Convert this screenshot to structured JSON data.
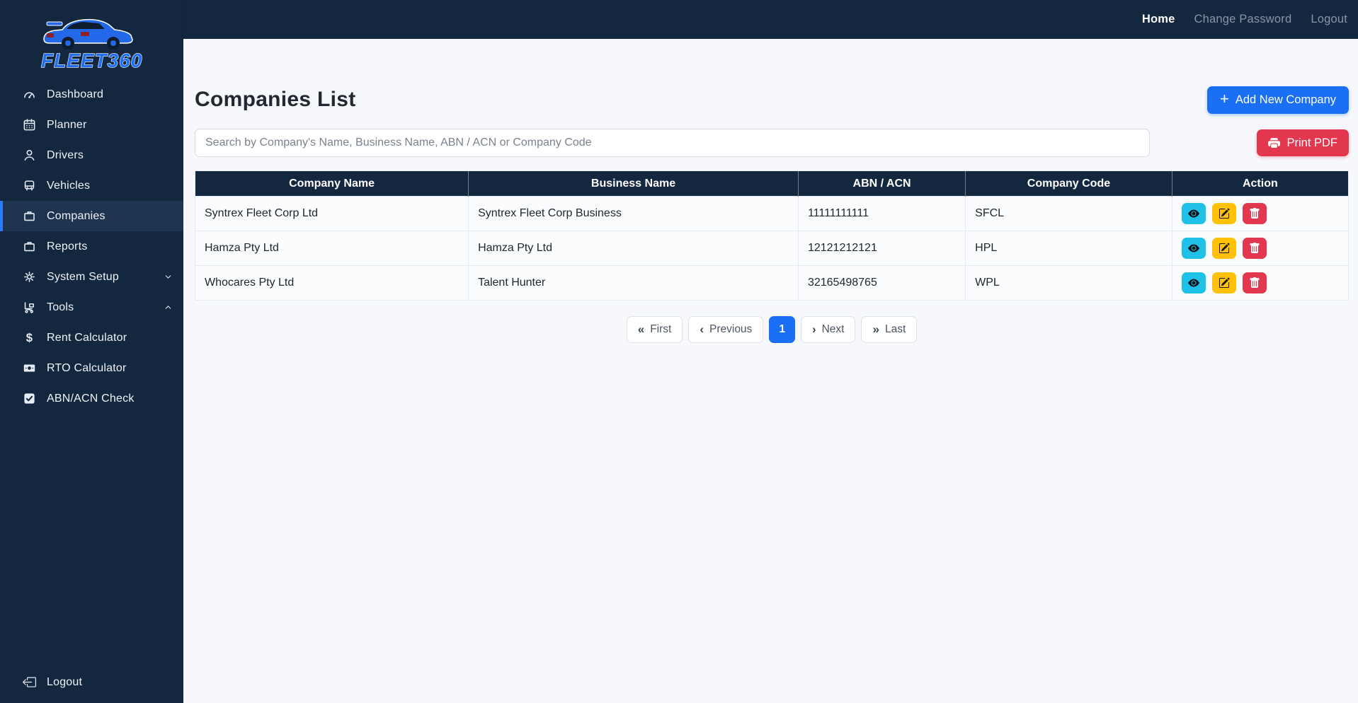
{
  "brand": {
    "name": "FLEET360",
    "logo_icon": "sports-car"
  },
  "topbar": {
    "home": "Home",
    "change_password": "Change Password",
    "logout": "Logout"
  },
  "sidebar": {
    "items": [
      {
        "label": "Dashboard",
        "icon": "speedometer"
      },
      {
        "label": "Planner",
        "icon": "calendar"
      },
      {
        "label": "Drivers",
        "icon": "person"
      },
      {
        "label": "Vehicles",
        "icon": "vehicle-front"
      },
      {
        "label": "Companies",
        "icon": "briefcase",
        "active": true
      },
      {
        "label": "Reports",
        "icon": "briefcase"
      },
      {
        "label": "System Setup",
        "icon": "gear",
        "chevron": "down"
      },
      {
        "label": "Tools",
        "icon": "tools",
        "chevron": "up"
      },
      {
        "label": "Rent Calculator",
        "icon": "dollar"
      },
      {
        "label": "RTO Calculator",
        "icon": "cash"
      },
      {
        "label": "ABN/ACN Check",
        "icon": "check-square"
      }
    ],
    "footer": {
      "label": "Logout",
      "icon": "box-arrow-left"
    }
  },
  "page": {
    "title": "Companies List",
    "add_button": "Add New Company",
    "print_button": "Print PDF",
    "search_placeholder": "Search by Company's Name, Business Name, ABN / ACN or Company Code"
  },
  "table": {
    "columns": [
      "Company Name",
      "Business Name",
      "ABN / ACN",
      "Company Code",
      "Action"
    ],
    "rows": [
      {
        "company_name": "Syntrex Fleet Corp Ltd",
        "business_name": "Syntrex Fleet Corp Business",
        "abn_acn": "11111111111",
        "company_code": "SFCL"
      },
      {
        "company_name": "Hamza Pty Ltd",
        "business_name": "Hamza Pty Ltd",
        "abn_acn": "12121212121",
        "company_code": "HPL"
      },
      {
        "company_name": "Whocares Pty Ltd",
        "business_name": "Talent Hunter",
        "abn_acn": "32165498765",
        "company_code": "WPL"
      }
    ],
    "row_action_icons": [
      "eye",
      "pencil-square",
      "trash"
    ]
  },
  "pagination": {
    "first": "First",
    "previous": "Previous",
    "page": "1",
    "next": "Next",
    "last": "Last"
  },
  "colors": {
    "navy": "#13273F",
    "sidebar_active_bg": "#1E3450",
    "accent_blue": "#1A6FF4",
    "danger_red": "#E2374E",
    "view_cyan": "#1FC1E8",
    "edit_yellow": "#FFC107",
    "page_bg": "#F7F8FC"
  }
}
